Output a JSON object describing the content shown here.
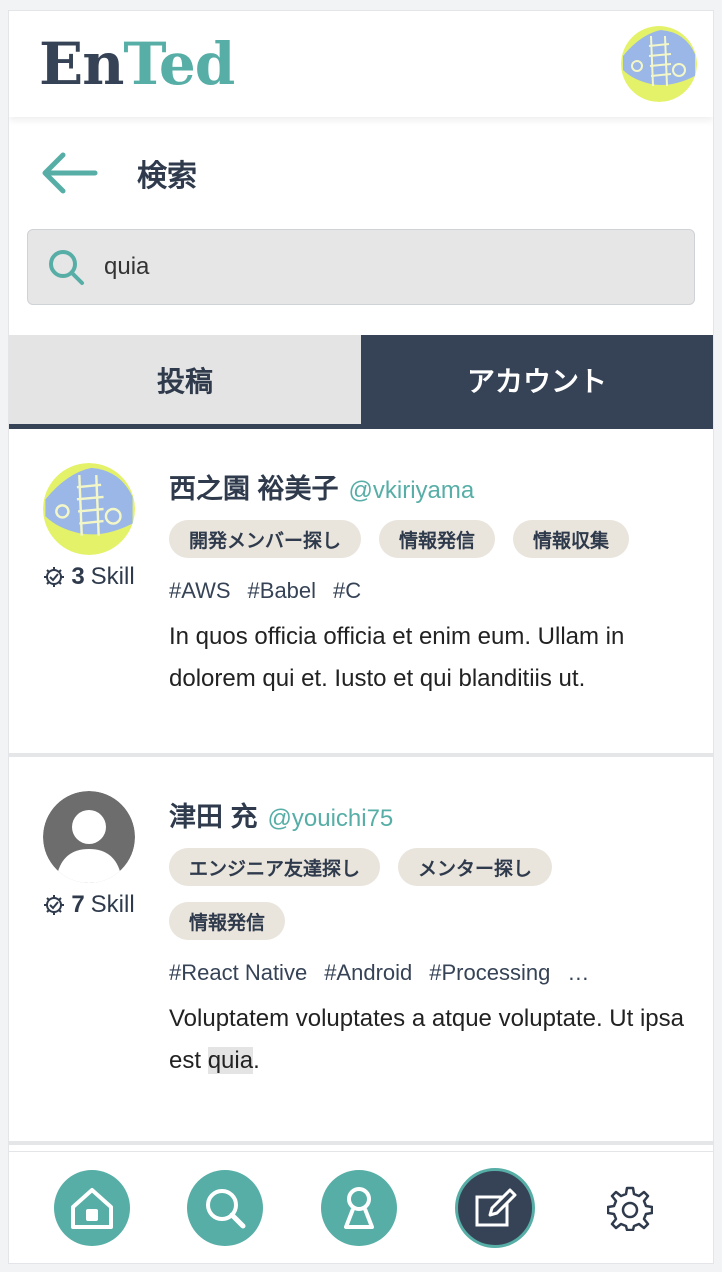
{
  "header": {
    "logo_part1": "En",
    "logo_part2": "Ted"
  },
  "search": {
    "title": "検索",
    "query": "quia"
  },
  "tabs": [
    {
      "label": "投稿",
      "active": false
    },
    {
      "label": "アカウント",
      "active": true
    }
  ],
  "results": [
    {
      "name": "西之園 裕美子",
      "handle": "@vkiriyama",
      "skill_count": "3",
      "skill_label": "Skill",
      "badges": [
        "開発メンバー探し",
        "情報発信",
        "情報収集"
      ],
      "tags": [
        "#AWS",
        "#Babel",
        "#C"
      ],
      "bio": "In quos officia officia et enim eum. Ullam in dolorem qui et. Iusto et qui blanditiis ut."
    },
    {
      "name": "津田 充",
      "handle": "@youichi75",
      "skill_count": "7",
      "skill_label": "Skill",
      "badges": [
        "エンジニア友達探し",
        "メンター探し",
        "情報発信"
      ],
      "tags": [
        "#React Native",
        "#Android",
        "#Processing",
        "…"
      ],
      "bio_before": "Voluptatem voluptates a atque voluptate. Ut ipsa est ",
      "bio_highlight": "quia",
      "bio_after": "."
    }
  ],
  "footer": {
    "icons": [
      "home-icon",
      "search-icon",
      "profile-icon",
      "compose-icon",
      "gear-icon"
    ]
  },
  "colors": {
    "primary": "#364356",
    "accent": "#56aea6",
    "badge": "#e9e4dc",
    "avatar_yellow": "#e4f26a",
    "avatar_blue": "#9bb7e8"
  }
}
